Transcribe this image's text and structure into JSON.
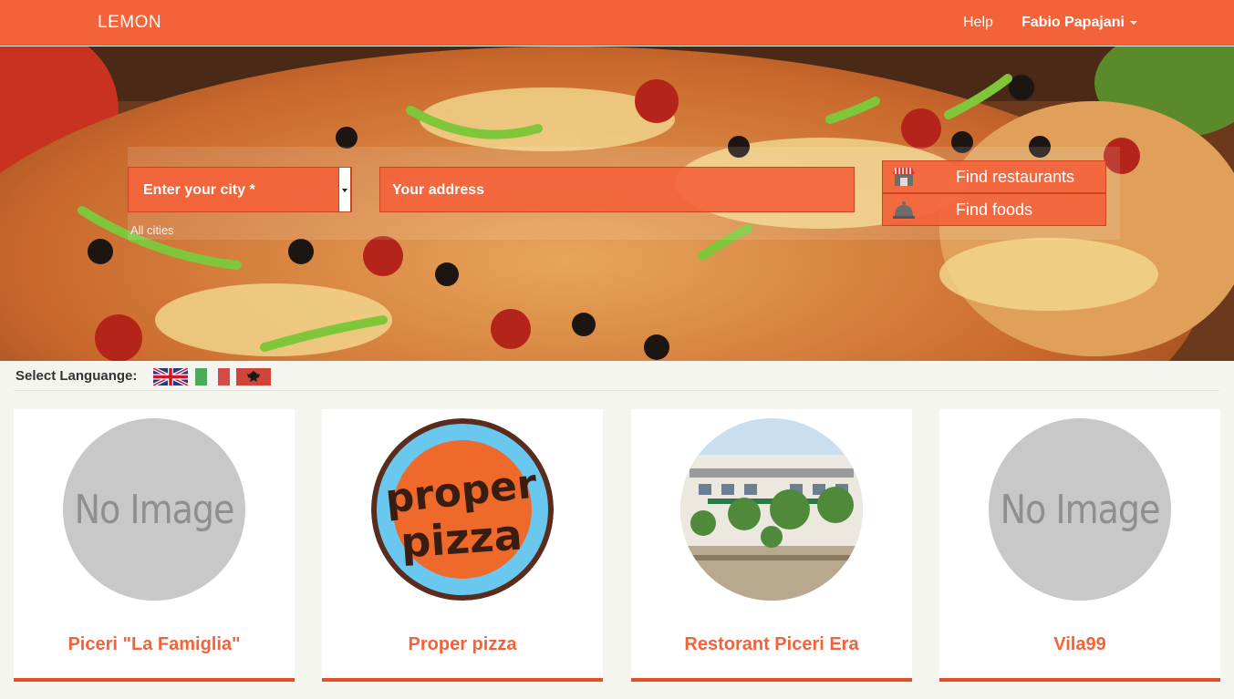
{
  "navbar": {
    "brand": "LEMON",
    "help": "Help",
    "user": "Fabio Papajani"
  },
  "search": {
    "city_placeholder": "Enter your city *",
    "city_hint": "All cities",
    "address_placeholder": "Your address",
    "find_restaurants": "Find restaurants",
    "find_foods": "Find foods"
  },
  "language": {
    "label": "Select Languange:",
    "flags": [
      "flag-uk-icon",
      "flag-italy-icon",
      "flag-albania-icon"
    ]
  },
  "restaurants": [
    {
      "name": "Piceri \"La Famiglia\"",
      "image": "no-image",
      "no_image_text": "No Image"
    },
    {
      "name": "Proper pizza",
      "image": "proper-pizza-logo",
      "logo_line1": "proper",
      "logo_line2": "pizza"
    },
    {
      "name": "Restorant Piceri Era",
      "image": "restaurant-building-photo"
    },
    {
      "name": "Vila99",
      "image": "no-image",
      "no_image_text": "No Image"
    }
  ],
  "colors": {
    "brand": "#f4623a",
    "card_border": "#e0512c",
    "page_bg": "#f5f5f0"
  }
}
